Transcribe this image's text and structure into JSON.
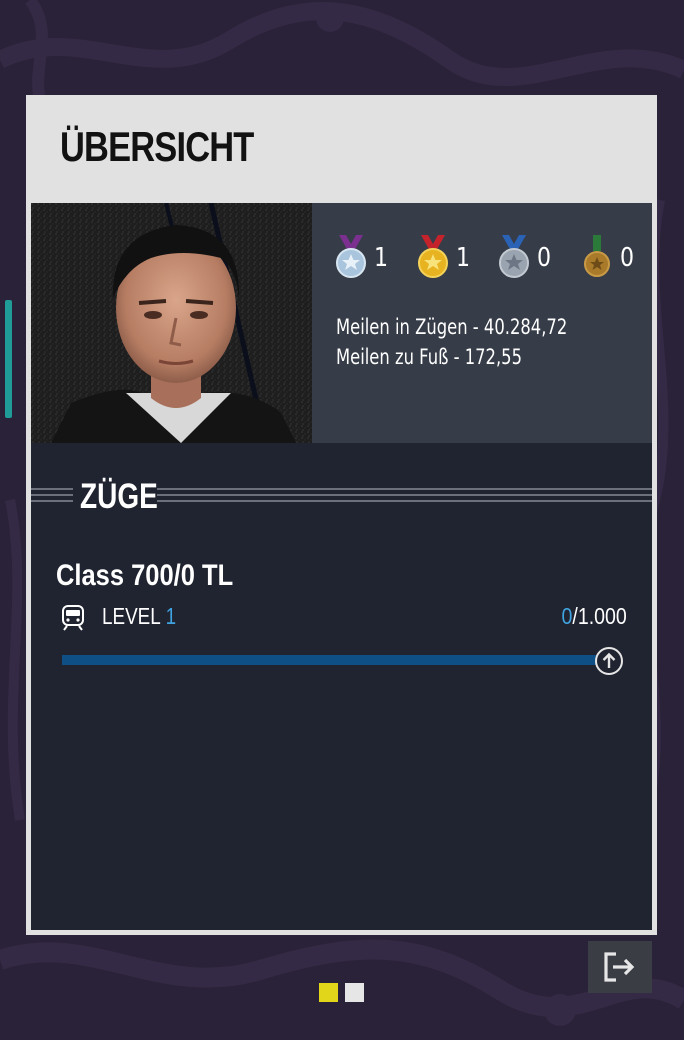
{
  "title": "ÜBERSICHT",
  "stats": {
    "medals": [
      {
        "name": "purple-medal-icon",
        "count": "1",
        "ribbon": "#7b2f8f",
        "disc": "#a9c4dd"
      },
      {
        "name": "red-medal-icon",
        "count": "1",
        "ribbon": "#c4232b",
        "disc": "#e8b320"
      },
      {
        "name": "blue-medal-icon",
        "count": "0",
        "ribbon": "#2a62b5",
        "disc": "#9aa3b0"
      },
      {
        "name": "green-medal-icon",
        "count": "0",
        "ribbon": "#2b7a3a",
        "disc": "#a87a2a"
      }
    ],
    "miles_trains": "Meilen in Zügen - 40.284,72",
    "miles_foot": "Meilen zu Fuß - 172,55"
  },
  "section": {
    "title": "ZÜGE"
  },
  "train": {
    "name": "Class 700/0 TL",
    "level_label": "LEVEL",
    "level": "1",
    "xp_current": "0",
    "xp_max": "/1.000",
    "progress": 1.0
  },
  "pager": {
    "active_color": "#e2d61a",
    "inactive_color": "#e6e6e6",
    "pages": 2,
    "active": 0
  },
  "colors": {
    "accent_teal": "#1f9b98",
    "accent_blue": "#3fa3e0",
    "progress_blue": "#0e4f86"
  }
}
